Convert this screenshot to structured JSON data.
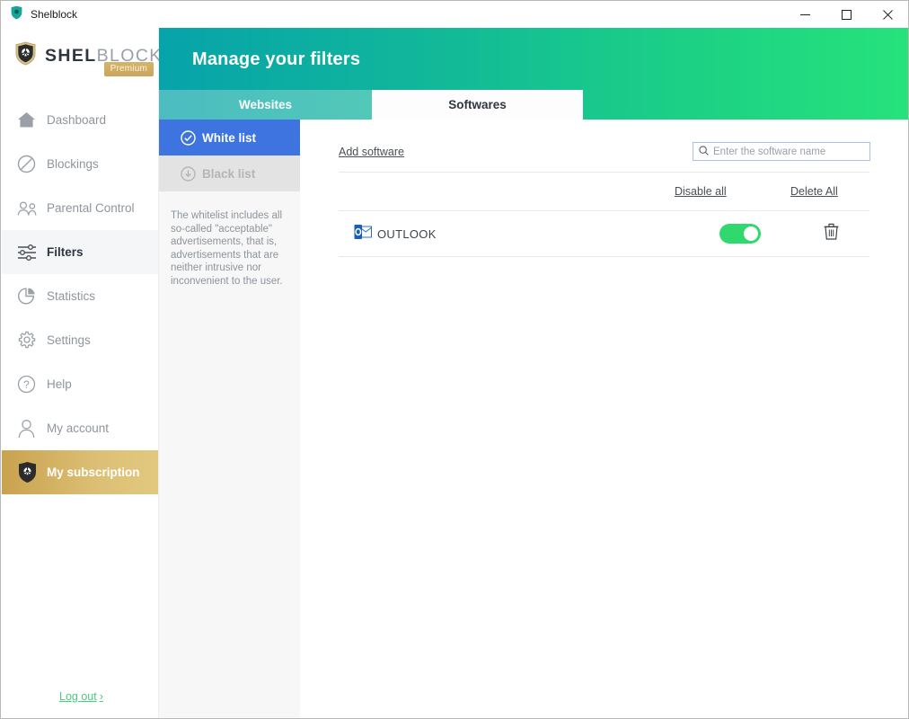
{
  "window": {
    "title": "Shelblock",
    "app_icon": "shield-icon",
    "minimize_label": "–",
    "maximize_label": "☐",
    "close_label": "✕"
  },
  "brand": {
    "icon": "shelblock-shield-logo",
    "name_bold": "SHEL",
    "name_light": "BLOCK",
    "badge": "Premium"
  },
  "sidebar": {
    "items": [
      {
        "label": "Dashboard",
        "icon": "home-icon",
        "state": "default"
      },
      {
        "label": "Blockings",
        "icon": "block-icon",
        "state": "default"
      },
      {
        "label": "Parental Control",
        "icon": "people-icon",
        "state": "default"
      },
      {
        "label": "Filters",
        "icon": "sliders-icon",
        "state": "active"
      },
      {
        "label": "Statistics",
        "icon": "pie-chart-icon",
        "state": "default"
      },
      {
        "label": "Settings",
        "icon": "gear-icon",
        "state": "default"
      },
      {
        "label": "Help",
        "icon": "question-icon",
        "state": "default"
      },
      {
        "label": "My account",
        "icon": "user-icon",
        "state": "default"
      },
      {
        "label": "My subscription",
        "icon": "shield-icon",
        "state": "selected"
      }
    ],
    "logout": {
      "label": "Log out",
      "chevron": "›"
    }
  },
  "header": {
    "title": "Manage your filters",
    "gradient_from": "#07a3aa",
    "gradient_to": "#26e27b",
    "tabs": [
      {
        "label": "Websites",
        "active": false
      },
      {
        "label": "Softwares",
        "active": true
      }
    ]
  },
  "subpanel": {
    "lists": [
      {
        "label": "White list",
        "icon": "check-circle-icon",
        "active": true
      },
      {
        "label": "Black list",
        "icon": "down-circle-icon",
        "active": false
      }
    ],
    "description": "The whitelist includes all so-called \"acceptable\" advertisements, that is, advertisements that are neither intrusive nor inconvenient to the user."
  },
  "main": {
    "add_software_label": "Add software",
    "search": {
      "placeholder": "Enter the software name",
      "value": "",
      "icon": "search-icon"
    },
    "bulk_actions": {
      "disable_all": "Disable all",
      "delete_all": "Delete All"
    },
    "software_rows": [
      {
        "name": "OUTLOOK",
        "icon": "outlook-icon",
        "enabled": true,
        "toggle_color": "#2fd96e",
        "delete_icon": "trash-icon"
      }
    ]
  }
}
